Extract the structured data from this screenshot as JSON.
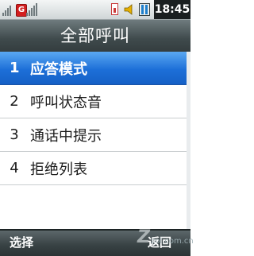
{
  "status": {
    "time": "18:45",
    "network_badge": "G",
    "icons": [
      "signal-icon",
      "network-g-icon",
      "signal-icon",
      "sim-icon",
      "speaker-icon",
      "battery-icon"
    ]
  },
  "title": "全部呼叫",
  "menu": {
    "items": [
      {
        "number": "1",
        "label": "应答模式",
        "selected": true
      },
      {
        "number": "2",
        "label": "呼叫状态音",
        "selected": false
      },
      {
        "number": "3",
        "label": "通话中提示",
        "selected": false
      },
      {
        "number": "4",
        "label": "拒绝列表",
        "selected": false
      }
    ]
  },
  "softkeys": {
    "left": "选择",
    "right": "返回"
  },
  "watermark": {
    "text": "zol.com.cn"
  },
  "colors": {
    "selection": "#1d6fd8",
    "titlebar": "#3f4a4c",
    "softbar": "#374143"
  }
}
